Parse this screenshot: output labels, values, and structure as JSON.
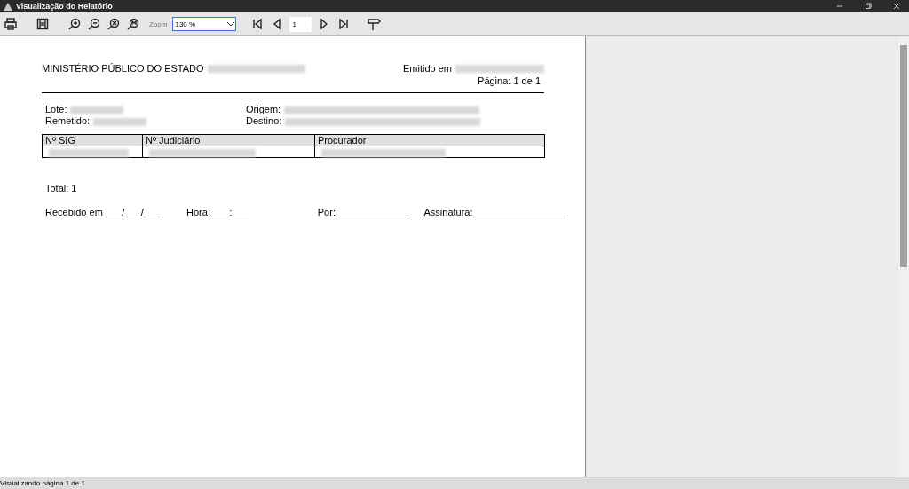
{
  "window": {
    "title": "Visualização do Relatório"
  },
  "toolbar": {
    "zoom_label": "Zoom",
    "zoom_value": "130 %",
    "page_value": "1"
  },
  "report": {
    "header": "MINISTÉRIO PÚBLICO DO ESTADO",
    "emitted_label": "Emitido em",
    "page_label": "Página: 1 de 1",
    "fields_left": [
      {
        "label": "Lote:"
      },
      {
        "label": "Remetido:"
      }
    ],
    "fields_right": [
      {
        "label": "Origem:"
      },
      {
        "label": "Destino:"
      }
    ],
    "table": {
      "columns": [
        "Nº SIG",
        "Nº Judiciário",
        "Procurador"
      ]
    },
    "total": "Total: 1",
    "signature_line": [
      {
        "text": "Recebido em ___/___/___"
      },
      {
        "text": "Hora: ___:___"
      },
      {
        "text": "Por:_____________"
      },
      {
        "text": "Assinatura:_________________"
      }
    ]
  },
  "status_bar": "Visualizando página 1 de 1"
}
